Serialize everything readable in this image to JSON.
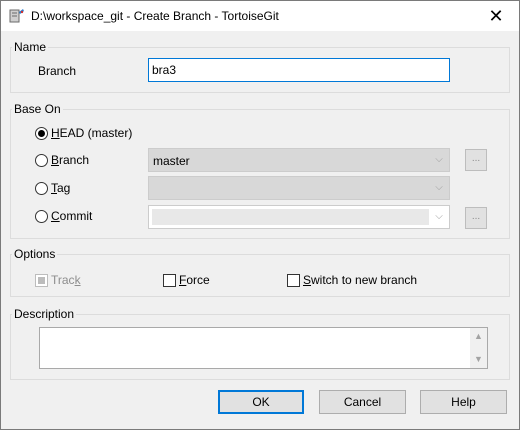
{
  "window": {
    "title": "D:\\workspace_git - Create Branch - TortoiseGit",
    "close_glyph": "✕"
  },
  "name_group": {
    "title": "Name",
    "branch_label": "Branch",
    "branch_value": "bra3"
  },
  "base_on_group": {
    "title": "Base On",
    "options": {
      "head": {
        "accel": "H",
        "rest": "EAD (master)",
        "selected": true
      },
      "branch": {
        "accel": "B",
        "rest": "ranch",
        "selected": false
      },
      "tag": {
        "accel": "T",
        "rest": "ag",
        "selected": false
      },
      "commit": {
        "accel": "C",
        "rest": "ommit",
        "selected": false
      }
    },
    "branch_combo_value": "master",
    "browse_glyph": "...",
    "dropdown_glyph": "⌵"
  },
  "options_group": {
    "title": "Options",
    "track": {
      "pre": "Trac",
      "accel": "k",
      "checked": "indeterminate",
      "disabled": true
    },
    "force": {
      "accel": "F",
      "rest": "orce",
      "checked": false
    },
    "switch": {
      "accel": "S",
      "rest": "witch to new branch",
      "checked": false
    }
  },
  "description_group": {
    "title": "Description",
    "value": "",
    "scroll_up_glyph": "▲",
    "scroll_down_glyph": "▼"
  },
  "buttons": {
    "ok": "OK",
    "cancel": "Cancel",
    "help": "Help"
  },
  "colors": {
    "accent": "#0078d7",
    "dialog_bg": "#f0f0f0"
  }
}
